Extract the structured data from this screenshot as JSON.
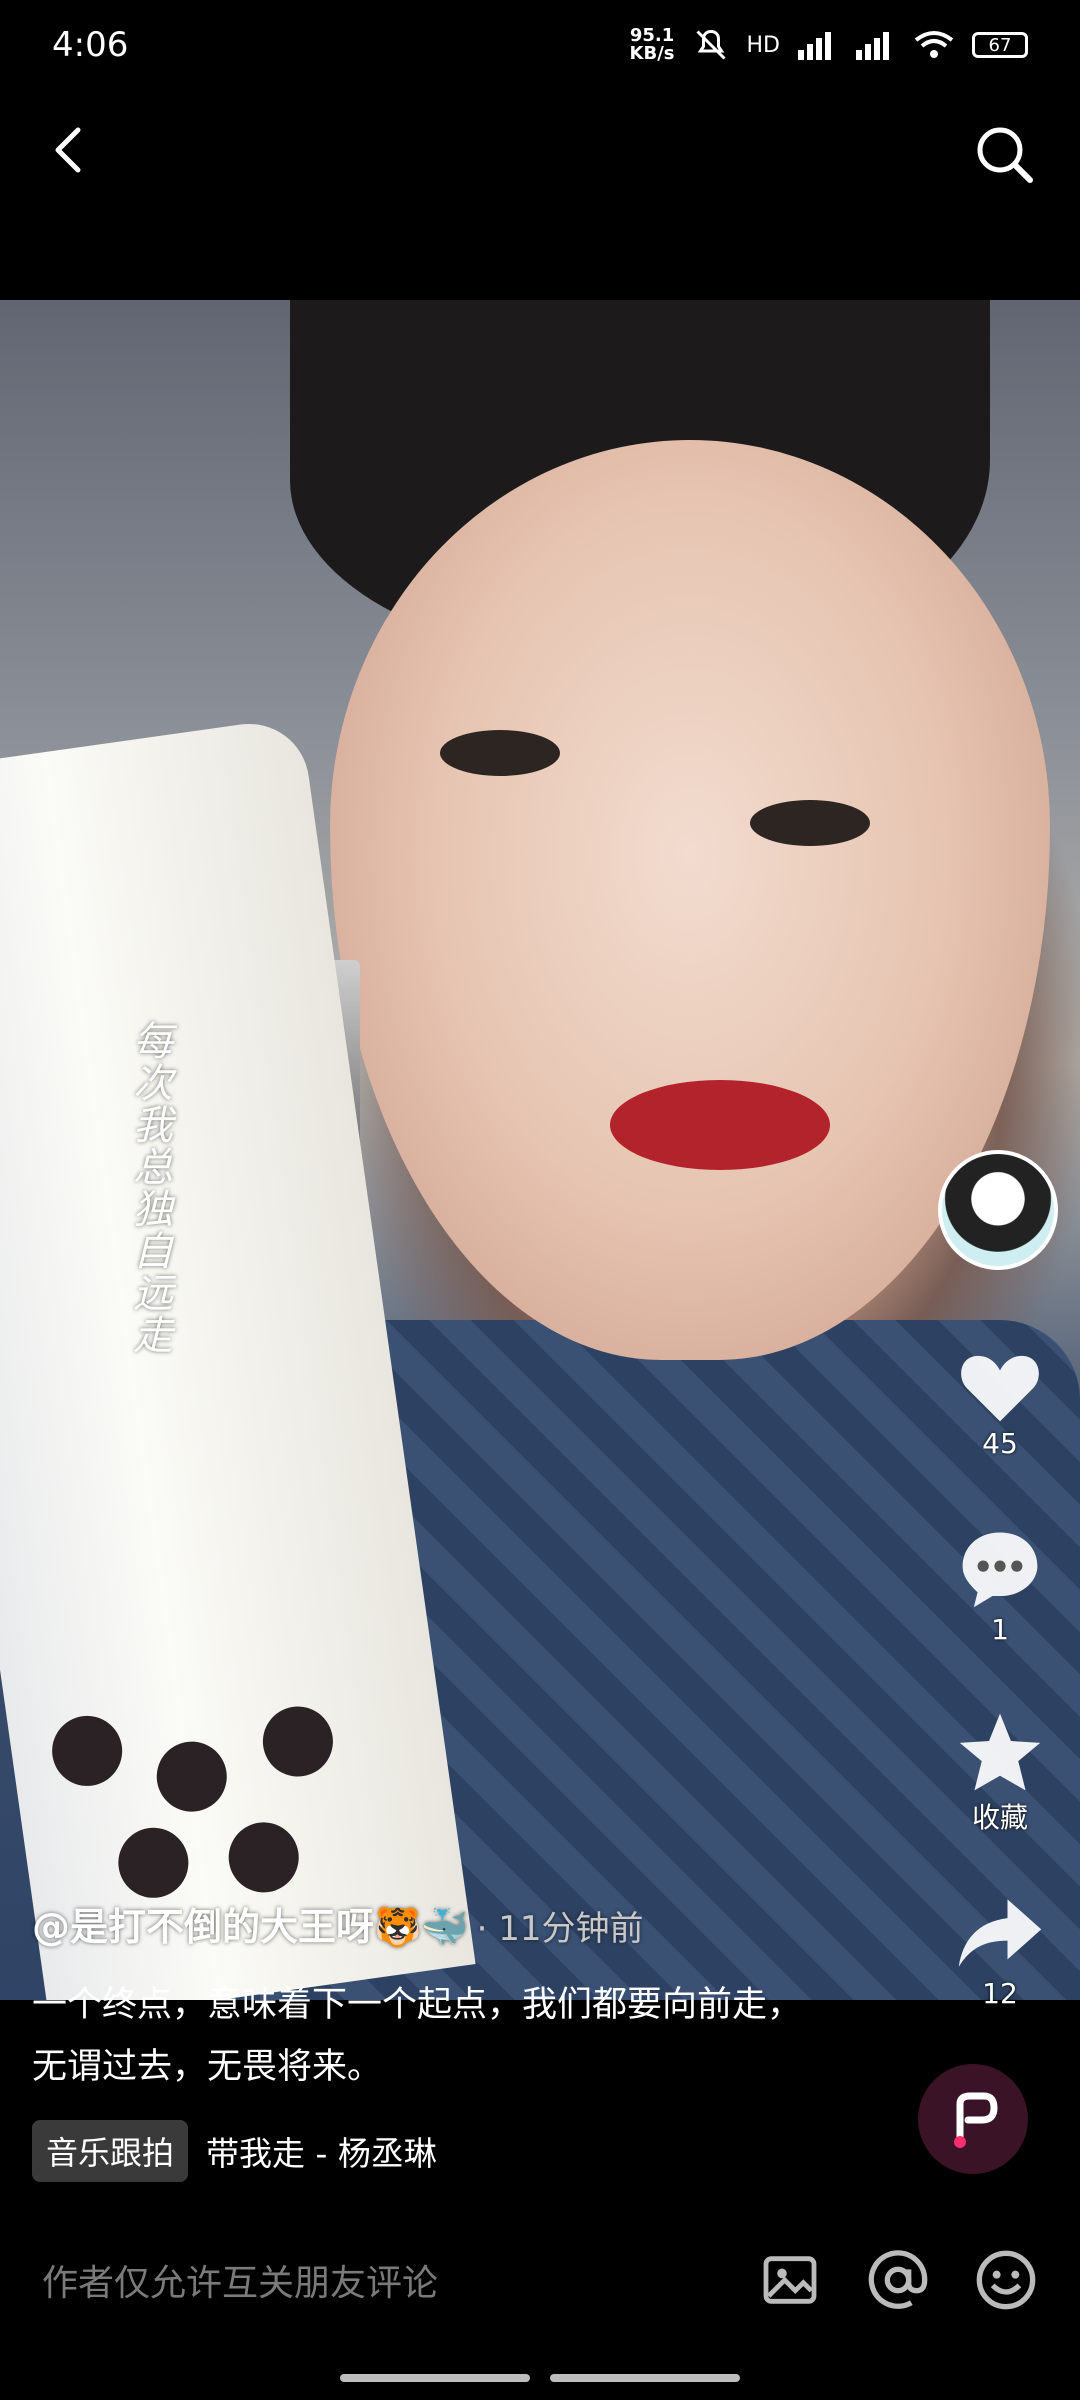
{
  "status_bar": {
    "time": "4:06",
    "net_speed_value": "95.1",
    "net_speed_unit": "KB/s",
    "signal_label": "HD",
    "battery": "67"
  },
  "video": {
    "overlay_text": "每次我总独自远走"
  },
  "post": {
    "author": "@是打不倒的大王呀",
    "author_emoji": "🐯🐳",
    "time_ago": "· 11分钟前",
    "description": "一个终点，意味着下一个起点，我们都要向前走，无谓过去，无畏将来。",
    "music_tag": "音乐跟拍",
    "music_name": "带我走 - 杨丞琳"
  },
  "actions": {
    "likes": "45",
    "comments": "1",
    "favorite_label": "收藏",
    "shares": "12"
  },
  "comment_bar": {
    "placeholder": "作者仅允许互关朋友评论"
  },
  "icons": {
    "back": "back-arrow-icon",
    "search": "search-icon",
    "like": "heart-icon",
    "comment": "comment-bubble-icon",
    "favorite": "star-icon",
    "share": "share-arrow-icon",
    "image": "image-icon",
    "mention": "at-icon",
    "emoji": "emoji-icon"
  },
  "colors": {
    "background": "#000000",
    "text_primary": "#ffffff",
    "text_muted": "#7a7a7a",
    "music_disc": "#3a1326"
  }
}
